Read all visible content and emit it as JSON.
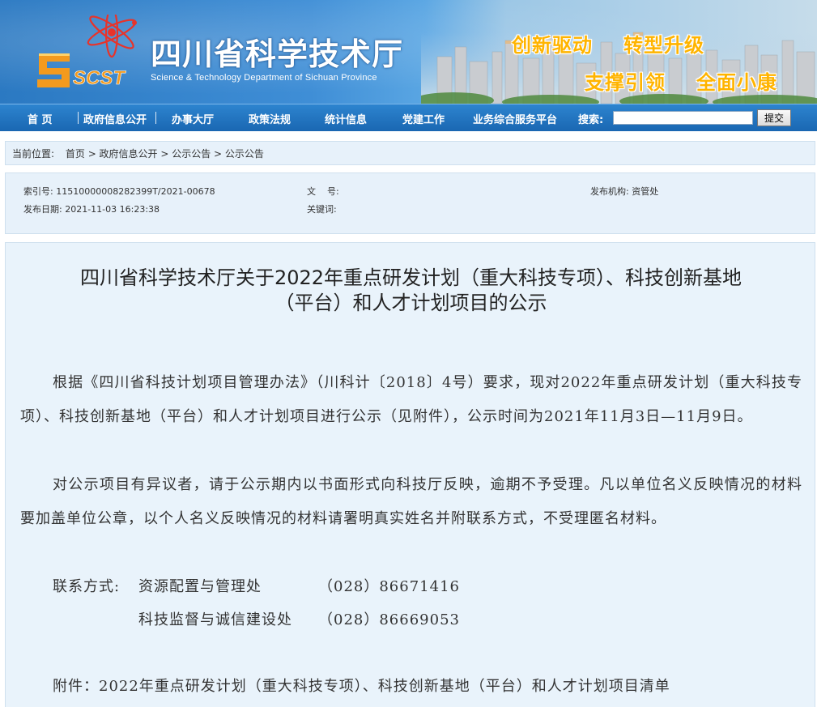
{
  "header": {
    "logo_text": "SCST",
    "site_title": "四川省科学技术厅",
    "site_subtitle": "Science & Technology Department of Sichuan Province",
    "slogans": [
      "创新驱动",
      "转型升级",
      "支撑引领",
      "全面小康"
    ]
  },
  "nav": {
    "items": [
      "首 页",
      "政府信息公开",
      "办事大厅",
      "政策法规",
      "统计信息",
      "党建工作",
      "业务综合服务平台"
    ],
    "search_label": "搜索:",
    "search_value": "",
    "submit_label": "提交"
  },
  "breadcrumb": {
    "label": "当前位置:",
    "path": "首页 > 政府信息公开 > 公示公告 > 公示公告"
  },
  "meta": {
    "index_label": "索引号:",
    "index_value": "11510000008282399T/2021-00678",
    "doc_no_label": "文    号:",
    "doc_no_value": "",
    "issuer_label": "发布机构:",
    "issuer_value": "资管处",
    "date_label": "发布日期:",
    "date_value": "2021-11-03 16:23:38",
    "keywords_label": "关键词:",
    "keywords_value": ""
  },
  "article": {
    "title_line1": "四川省科学技术厅关于2022年重点研发计划（重大科技专项）、科技创新基地",
    "title_line2": "（平台）和人才计划项目的公示",
    "para1": "根据《四川省科技计划项目管理办法》（川科计〔2018〕4号）要求，现对2022年重点研发计划（重大科技专项）、科技创新基地（平台）和人才计划项目进行公示（见附件），公示时间为2021年11月3日—11月9日。",
    "para2": "对公示项目有异议者，请于公示期内以书面形式向科技厅反映，逾期不予受理。凡以单位名义反映情况的材料要加盖单位公章，以个人名义反映情况的材料请署明真实姓名并附联系方式，不受理匿名材料。",
    "contact_label": "联系方式:",
    "contacts": [
      {
        "dept": "资源配置与管理处",
        "phone": "（028）86671416"
      },
      {
        "dept": "科技监督与诚信建设处",
        "phone": "（028）86669053"
      }
    ],
    "attachment": "附件：2022年重点研发计划（重大科技专项）、科技创新基地（平台）和人才计划项目清单"
  }
}
